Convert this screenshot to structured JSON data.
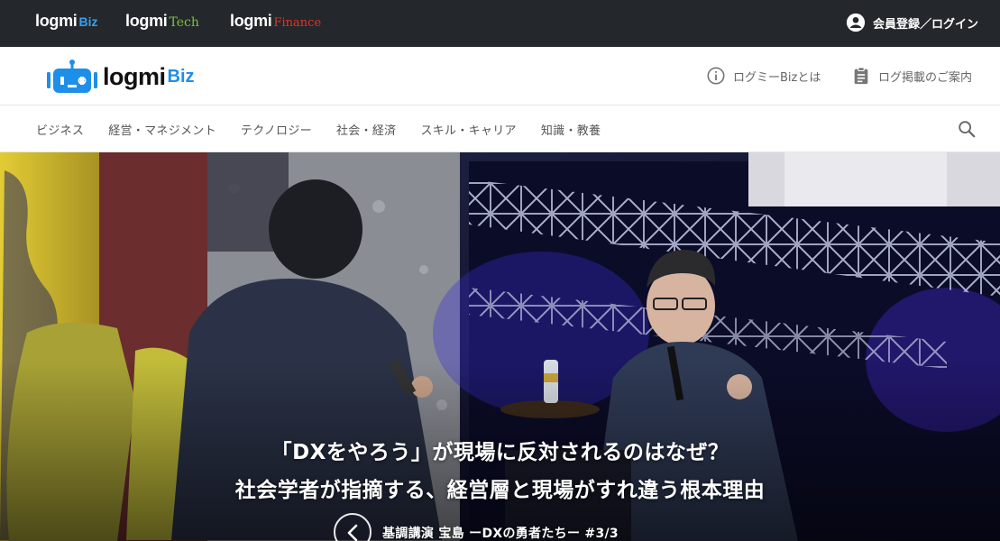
{
  "network_bar": {
    "sites": [
      {
        "word": "logmi",
        "suffix": "Biz"
      },
      {
        "word": "logmi",
        "suffix": "Tech"
      },
      {
        "word": "logmi",
        "suffix": "Finance"
      }
    ],
    "login_label": "会員登録／ログイン",
    "login_icon": "account-circle-icon"
  },
  "header": {
    "logo_word": "logmi",
    "logo_suffix": "Biz",
    "logo_tagline": "ログミー",
    "about_label": "ログミーBizとは",
    "about_icon": "info-icon",
    "guide_label": "ログ掲載のご案内",
    "guide_icon": "clipboard-icon"
  },
  "category_nav": {
    "items": [
      "ビジネス",
      "経営・マネジメント",
      "テクノロジー",
      "社会・経済",
      "スキル・キャリア",
      "知識・教養"
    ],
    "search_icon": "search-icon"
  },
  "hero": {
    "title_line1": "「DXをやろう」が現場に反対されるのはなぜ？",
    "title_line2": "社会学者が指摘する、経営層と現場がすれ違う根本理由",
    "series_label": "基調講演 宝島 ーDXの勇者たちー #3/3",
    "prev_icon": "chevron-left-icon"
  },
  "colors": {
    "netbar_bg": "#24272b",
    "biz_blue": "#1e8fe8",
    "tech_green": "#7bc043",
    "finance_red": "#e0352b"
  }
}
